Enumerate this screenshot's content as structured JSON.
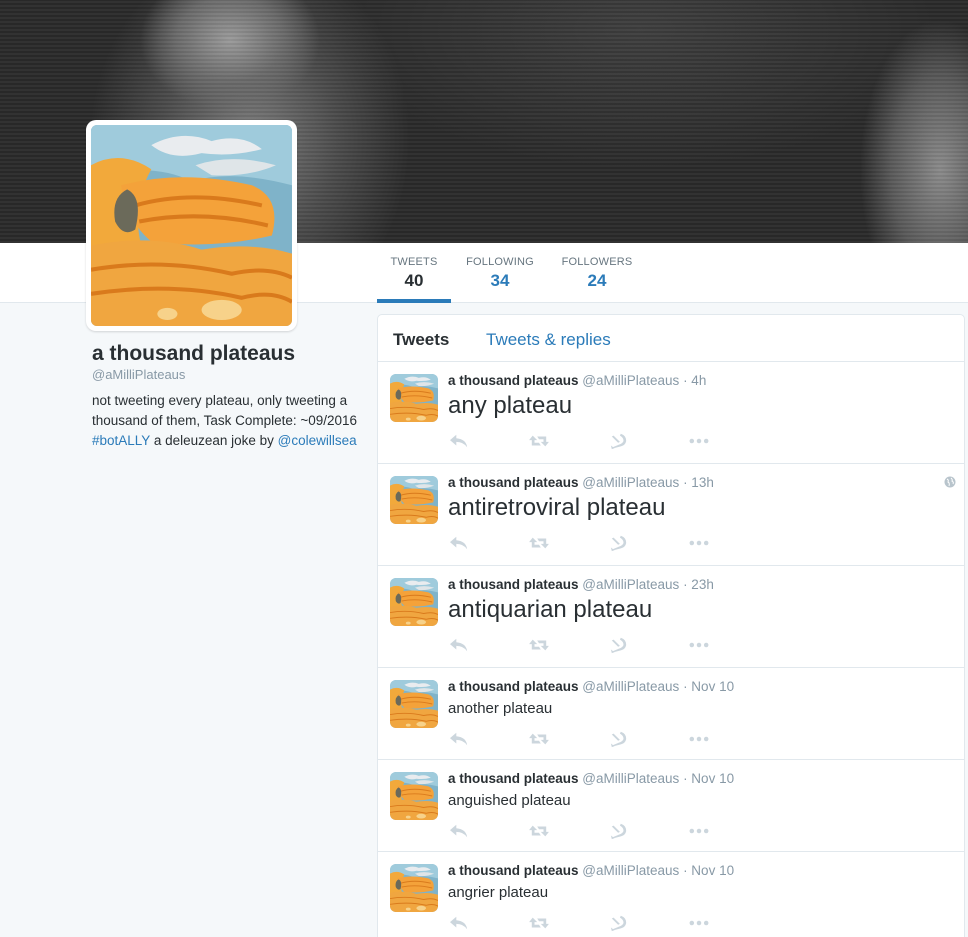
{
  "profile": {
    "name": "a thousand plateaus",
    "handle": "@aMilliPlateaus",
    "bio_part1": "not tweeting every plateau, only tweeting a thousand of them, Task Complete: ~09/2016 ",
    "bio_hashtag": "#botALLY",
    "bio_part2": " a deleuzean joke by ",
    "bio_mention": "@colewillsea"
  },
  "stats": {
    "tweets_label": "TWEETS",
    "tweets_value": "40",
    "following_label": "FOLLOWING",
    "following_value": "34",
    "followers_label": "FOLLOWERS",
    "followers_value": "24"
  },
  "timeline": {
    "tab_tweets": "Tweets",
    "tab_replies": "Tweets & replies",
    "tweets": [
      {
        "name": "a thousand plateaus",
        "handle": "@aMilliPlateaus",
        "time": "· 4h",
        "text": "any plateau"
      },
      {
        "name": "a thousand plateaus",
        "handle": "@aMilliPlateaus",
        "time": "· 13h",
        "text": "antiretroviral plateau"
      },
      {
        "name": "a thousand plateaus",
        "handle": "@aMilliPlateaus",
        "time": "· 23h",
        "text": "antiquarian plateau"
      },
      {
        "name": "a thousand plateaus",
        "handle": "@aMilliPlateaus",
        "time": "· Nov 10",
        "text": "another plateau"
      },
      {
        "name": "a thousand plateaus",
        "handle": "@aMilliPlateaus",
        "time": "· Nov 10",
        "text": "anguished plateau"
      },
      {
        "name": "a thousand plateaus",
        "handle": "@aMilliPlateaus",
        "time": "· Nov 10",
        "text": "angrier plateau"
      }
    ]
  },
  "colors": {
    "link": "#2b7bb9",
    "muted": "#8899a6",
    "action_icon": "#ccd6dd"
  },
  "icons": [
    "reply-icon",
    "retweet-icon",
    "hammer-sickle-icon",
    "more-icon",
    "globe-icon"
  ]
}
